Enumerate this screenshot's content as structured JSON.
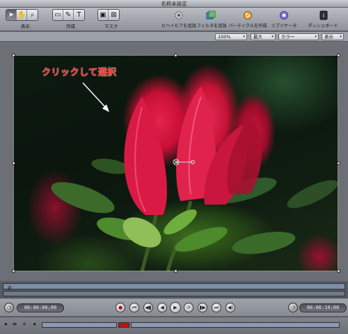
{
  "window": {
    "title": "名称未設定"
  },
  "toolbar": {
    "groups": [
      {
        "label": "表示",
        "buttons": [
          "select-arrow-icon",
          "hand-icon",
          "zoom-icon"
        ]
      },
      {
        "label": "作成",
        "buttons": [
          "rectangle-icon",
          "pen-icon",
          "text-icon"
        ]
      },
      {
        "label": "マスク",
        "buttons": [
          "mask-rect-icon",
          "mask-bezier-icon"
        ]
      }
    ],
    "actions": [
      {
        "label": "ビヘイビアを追加",
        "icon": "gear-icon"
      },
      {
        "label": "フィルタを追加",
        "icon": "filter-icon"
      },
      {
        "label": "パーティクルを作成",
        "icon": "particle-icon"
      },
      {
        "label": "リプリケータ",
        "icon": "replicator-icon"
      },
      {
        "label": "ダッシュボード",
        "icon": "dashboard-icon"
      }
    ]
  },
  "options": {
    "zoom": "100%",
    "resolution": "最大",
    "channel": "カラー",
    "view": "表示"
  },
  "canvas": {
    "annotation": "クリックして選択",
    "accent": "#ff2222"
  },
  "timeline": {
    "track_label": "花"
  },
  "transport": {
    "current_time": "00:00:00;00",
    "duration": "00:00:10;00"
  }
}
